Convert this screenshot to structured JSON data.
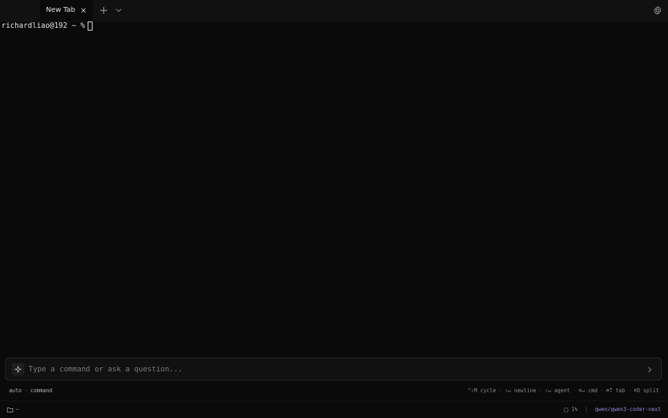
{
  "tabs": [
    {
      "label": "New Tab",
      "active": true,
      "close_icon": "close-icon",
      "close_glyph": "✕"
    }
  ],
  "tabbar": {
    "new_tab_icon": "plus-icon",
    "tab_menu_icon": "chevron-down-icon",
    "settings_icon": "gear-icon"
  },
  "terminal": {
    "prompt": "richardliao@192 ~ %",
    "cursor_style": "block-outline"
  },
  "input": {
    "placeholder": "Type a command or ask a question...",
    "value": "",
    "leading_icon": "sparkle-icon",
    "send_icon": "chevron-right-icon"
  },
  "mode": {
    "primary": "auto",
    "separator": "·",
    "secondary": "command"
  },
  "shortcuts": [
    {
      "keys": "^⇧M",
      "label": "cycle"
    },
    {
      "keys": "⇧↵",
      "label": "newline"
    },
    {
      "keys": "⇧↵",
      "label": "agent"
    },
    {
      "keys": "⌘↵",
      "label": "cmd"
    },
    {
      "keys": "⌘T",
      "label": "tab"
    },
    {
      "keys": "⌘D",
      "label": "split"
    }
  ],
  "status": {
    "folder_icon": "folder-icon",
    "cwd": "~",
    "usage_icon": "progress-ring-icon",
    "usage": "1%",
    "model": "qwen/qwen3-coder-next"
  },
  "colors": {
    "background": "#0a0a0a",
    "tabbar": "#111111",
    "accent_model": "#9b86d6",
    "text": "#e6e6e6",
    "muted": "#8a8a8a"
  }
}
